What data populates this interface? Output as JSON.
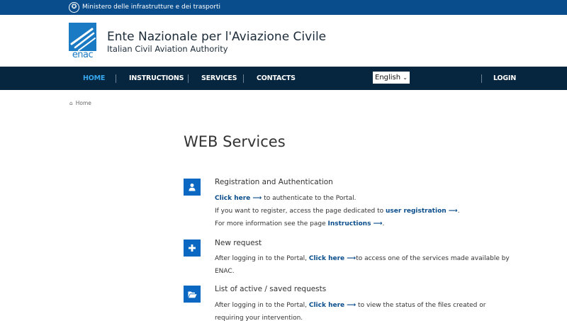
{
  "topbar": {
    "ministry": "Ministero delle infrastrutture e dei trasporti"
  },
  "header": {
    "logo_word": "enac",
    "org_name": "Ente Nazionale per l'Aviazione Civile",
    "org_subtitle": "Italian Civil Aviation Authority"
  },
  "nav": {
    "home": "HOME",
    "instructions": "INSTRUCTIONS",
    "services": "SERVICES",
    "contacts": "CONTACTS",
    "language": "English",
    "login": "LOGIN"
  },
  "breadcrumb": {
    "home": "Home"
  },
  "page": {
    "title": "WEB Services"
  },
  "services": {
    "registration": {
      "icon": "user-icon",
      "title": "Registration and Authentication",
      "l1_link": "Click here ⟶",
      "l1_text": " to authenticate to the Portal.",
      "l2_text": "If you want to register, access the page dedicated to ",
      "l2_link": "user registration ⟶",
      "l2_end": ".",
      "l3_text": "For more information see the page ",
      "l3_link": "Instructions ⟶",
      "l3_end": "."
    },
    "new_request": {
      "icon": "plus-icon",
      "title": "New request",
      "l1_text": "After logging in to the Portal, ",
      "l1_link": "Click here ⟶",
      "l1_end": "to access one of the services made available by",
      "l2_text": "ENAC."
    },
    "list_requests": {
      "icon": "folder-open-icon",
      "title": "List of active / saved requests",
      "l1_text": "After logging in to the Portal, ",
      "l1_link": "Click here ⟶",
      "l1_end": " to view the status of the files created or",
      "l2_text": "requiring your intervention."
    }
  },
  "colors": {
    "topbar": "#0a4d8c",
    "navbar": "#06263f",
    "nav_active": "#37a7ee",
    "accent": "#0a68c2",
    "link": "#0a4d8c"
  }
}
